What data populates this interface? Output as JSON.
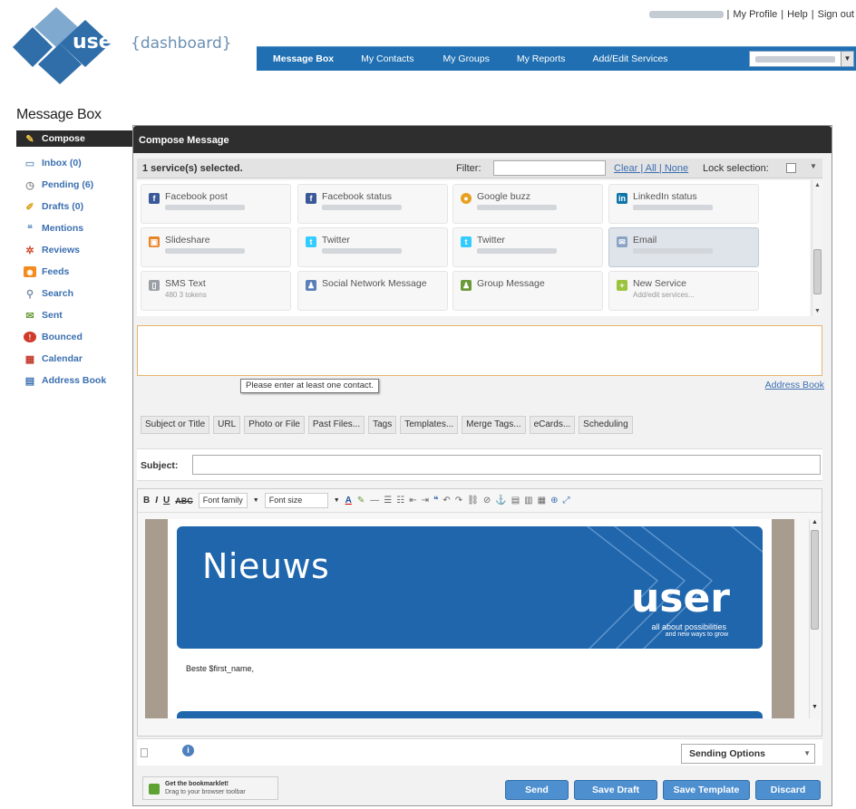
{
  "header": {
    "logo_word": "user",
    "logo_suffix": "{dashboard}",
    "links": [
      "My Profile",
      "Help",
      "Sign out"
    ]
  },
  "nav": {
    "items": [
      "Message Box",
      "My Contacts",
      "My Groups",
      "My Reports",
      "Add/Edit Services"
    ],
    "active": "Message Box"
  },
  "page_title": "Message Box",
  "sidebar": {
    "items": [
      {
        "label": "Compose",
        "icon": "compose-icon"
      },
      {
        "label": "Inbox (0)",
        "icon": "inbox-icon"
      },
      {
        "label": "Pending (6)",
        "icon": "pending-icon"
      },
      {
        "label": "Drafts (0)",
        "icon": "drafts-icon"
      },
      {
        "label": "Mentions",
        "icon": "mentions-icon"
      },
      {
        "label": "Reviews",
        "icon": "reviews-icon"
      },
      {
        "label": "Feeds",
        "icon": "feeds-icon"
      },
      {
        "label": "Search",
        "icon": "search-icon"
      },
      {
        "label": "Sent",
        "icon": "sent-icon"
      },
      {
        "label": "Bounced",
        "icon": "bounced-icon"
      },
      {
        "label": "Calendar",
        "icon": "calendar-icon"
      },
      {
        "label": "Address Book",
        "icon": "address-book-icon"
      }
    ]
  },
  "compose": {
    "title": "Compose Message",
    "selected_count": "1 service(s) selected.",
    "filter_label": "Filter:",
    "clear_links": "Clear | All | None",
    "lock_label": "Lock selection:",
    "services": [
      {
        "name": "Facebook post",
        "icon": "facebook-icon",
        "color": "#3b5998"
      },
      {
        "name": "Facebook status",
        "icon": "facebook-icon",
        "color": "#3b5998"
      },
      {
        "name": "Google buzz",
        "icon": "google-buzz-icon",
        "color": "#e8a020"
      },
      {
        "name": "LinkedIn status",
        "icon": "linkedin-icon",
        "color": "#0e76a8"
      },
      {
        "name": "Slideshare",
        "icon": "slideshare-icon",
        "color": "#e98325"
      },
      {
        "name": "Twitter",
        "icon": "twitter-icon",
        "color": "#33ccff"
      },
      {
        "name": "Twitter",
        "icon": "twitter-icon",
        "color": "#33ccff"
      },
      {
        "name": "Email",
        "icon": "email-icon",
        "color": "#8aa3c4",
        "selected": true
      },
      {
        "name": "SMS Text",
        "icon": "sms-icon",
        "color": "#9aa0a6",
        "sub": "480 3 tokens"
      },
      {
        "name": "Social Network Message",
        "icon": "social-network-icon",
        "color": "#5b7fb8"
      },
      {
        "name": "Group Message",
        "icon": "group-icon",
        "color": "#6b9a3a"
      },
      {
        "name": "New Service",
        "icon": "plus-icon",
        "color": "#9cc33c",
        "sub": "Add/edit services..."
      }
    ],
    "contact_tip": "Please enter at least one contact.",
    "address_book_link": "Address Book",
    "tool_tabs": [
      "Subject or Title",
      "URL",
      "Photo or File",
      "Past Files...",
      "Tags",
      "Templates...",
      "Merge Tags...",
      "eCards...",
      "Scheduling"
    ],
    "subject_label": "Subject:",
    "subject_value": "",
    "editor": {
      "font_family": "Font family",
      "font_size": "Font size",
      "newsletter_title": "Nieuws",
      "newsletter_brand": "user",
      "newsletter_tagline": "all about possibilities",
      "newsletter_tagline2": "and new ways to grow",
      "greeting": "Beste $first_name,"
    },
    "sending_options": "Sending Options",
    "bookmarklet_title": "Get the bookmarklet!",
    "bookmarklet_sub": "Drag to your browser toolbar",
    "buttons": [
      "Send",
      "Save Draft",
      "Save Template",
      "Discard"
    ],
    "accent_color": "#1f6fb2"
  }
}
